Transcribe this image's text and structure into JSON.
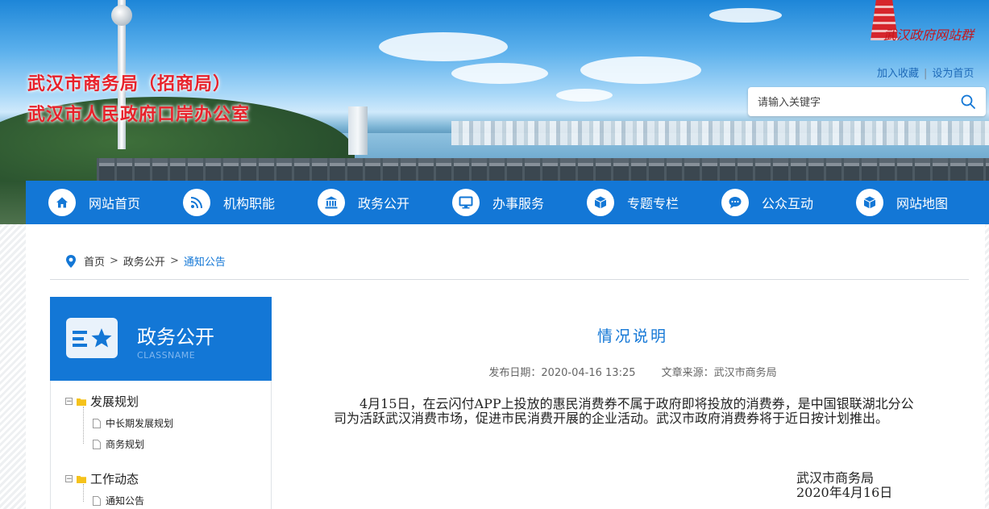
{
  "header": {
    "title_line1": "武汉市商务局（招商局）",
    "title_line2": "武汉市人民政府口岸办公室",
    "logo_text": "武汉政府网站群",
    "links": {
      "favorite": "加入收藏",
      "separator": "|",
      "homepage": "设为首页"
    },
    "search": {
      "placeholder": "请输入关键字"
    }
  },
  "nav": {
    "items": [
      {
        "label": "网站首页",
        "icon": "home-icon"
      },
      {
        "label": "机构职能",
        "icon": "rss-icon"
      },
      {
        "label": "政务公开",
        "icon": "institution-icon"
      },
      {
        "label": "办事服务",
        "icon": "monitor-icon"
      },
      {
        "label": "专题专栏",
        "icon": "cube-icon"
      },
      {
        "label": "公众互动",
        "icon": "chat-icon"
      },
      {
        "label": "网站地图",
        "icon": "cube-icon"
      }
    ]
  },
  "breadcrumb": {
    "items": [
      "首页",
      "政务公开",
      "通知公告"
    ],
    "separator": ">"
  },
  "sidebar": {
    "title": "政务公开",
    "subtitle": "CLASSNAME",
    "groups": [
      {
        "label": "发展规划",
        "toggle": "−",
        "children": [
          "中长期发展规划",
          "商务规划"
        ]
      },
      {
        "label": "工作动态",
        "toggle": "−",
        "children": [
          "通知公告"
        ]
      }
    ]
  },
  "article": {
    "title": "情况说明",
    "publish_date": "发布日期：2020-04-16 13:25",
    "source": "文章来源：武汉市商务局",
    "body": "4月15日，在云闪付APP上投放的惠民消费券不属于政府即将投放的消费券，是中国银联湖北分公司为活跃武汉消费市场，促进市民消费开展的企业活动。武汉市政府消费券将于近日按计划推出。",
    "sign_org": "武汉市商务局",
    "sign_date": "2020年4月16日"
  },
  "colors": {
    "primary": "#1377d6",
    "title_red": "#e8222b"
  }
}
